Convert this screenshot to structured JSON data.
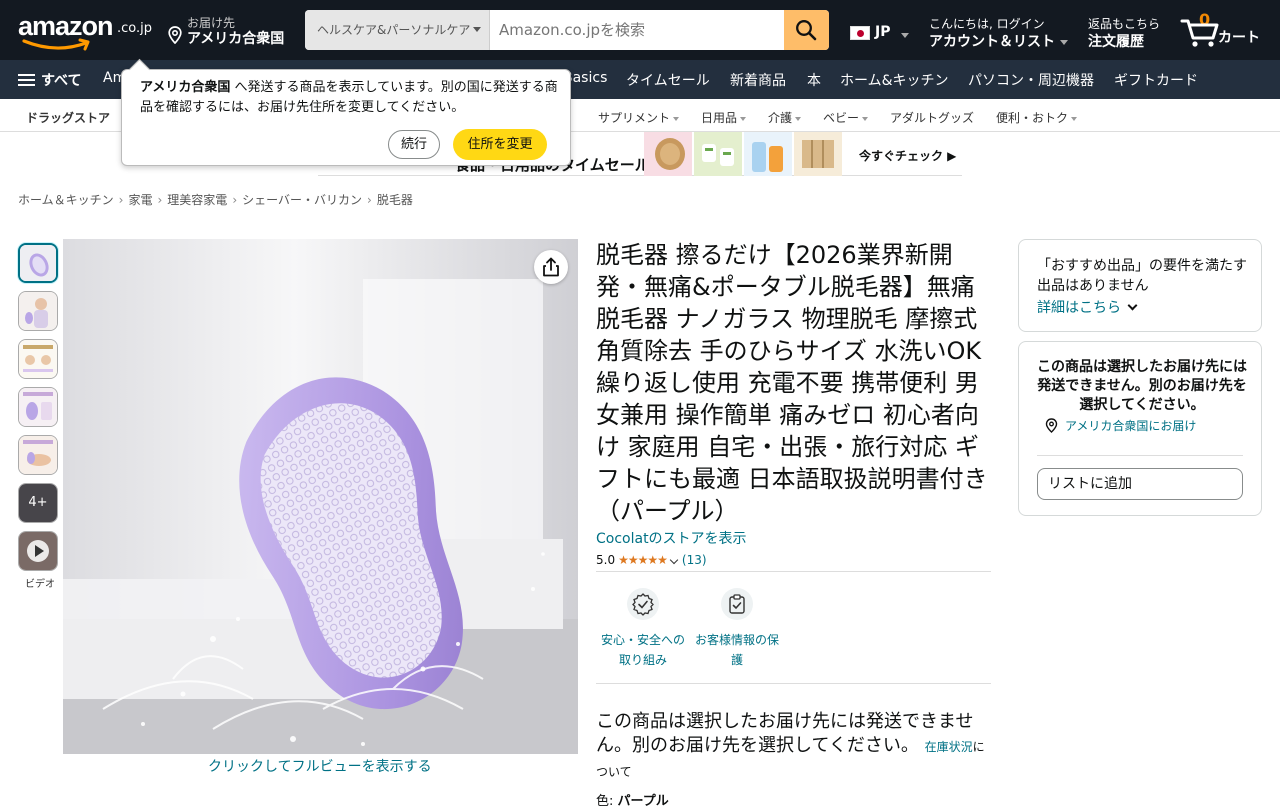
{
  "header": {
    "logo_text": "amazon",
    "logo_tld": ".co.jp",
    "deliver_label": "お届け先",
    "deliver_location": "アメリカ合衆国",
    "search_category": "ヘルスケア&パーソナルケア",
    "search_placeholder": "Amazon.co.jpを検索",
    "language": "JP",
    "account_greeting": "こんにちは, ログイン",
    "account_label": "アカウント＆リスト",
    "returns_label": "返品もこちら",
    "orders_label": "注文履歴",
    "cart_count": "0",
    "cart_label": "カート"
  },
  "nav": {
    "all_label": "すべて",
    "links": [
      "Am",
      "Basics",
      "タイムセール",
      "新着商品",
      "本",
      "ホーム&キッチン",
      "パソコン・周辺機器",
      "ギフトカード"
    ]
  },
  "subnav": {
    "category": "ドラッグストア",
    "items": [
      "サプリメント",
      "日用品",
      "介護",
      "ベビー",
      "アダルトグッズ",
      "便利・おトク"
    ]
  },
  "banner": {
    "text": "食品・日用品のタイムセール",
    "cta": "今すぐチェック ▶"
  },
  "popover": {
    "country": "アメリカ合衆国",
    "message": " へ発送する商品を表示しています。別の国に発送する商品を確認するには、お届け先住所を変更してください。",
    "continue_label": "続行",
    "change_label": "住所を変更"
  },
  "breadcrumb": [
    "ホーム＆キッチン",
    "家電",
    "理美容家電",
    "シェーバー・バリカン",
    "脱毛器"
  ],
  "gallery": {
    "more_label": "4+",
    "video_label": "ビデオ",
    "fullview_label": "クリックしてフルビューを表示する"
  },
  "product": {
    "title": "脱毛器 擦るだけ【2026業界新開発・無痛&ポータブル脱毛器】無痛脱毛器 ナノガラス 物理脱毛 摩擦式 角質除去 手のひらサイズ 水洗いOK 繰り返し使用 充電不要 携帯便利 男女兼用 操作簡単 痛みゼロ 初心者向け 家庭用 自宅・出張・旅行対応 ギフトにも最適 日本語取扱説明書付き（パープル）",
    "store_link": "Cocolatのストアを表示",
    "rating_value": "5.0",
    "stars": "★★★★★",
    "rating_count": "(13)",
    "badge_safety": "安心・安全への取り組み",
    "badge_privacy": "お客様情報の保護",
    "availability": "この商品は選択したお届け先には発送できません。別のお届け先を選択してください。",
    "stock_link": "在庫状況",
    "stock_suffix": "について",
    "color_label": "色: ",
    "color_value": "パープル"
  },
  "buybox": {
    "featured_msg": "「おすすめ出品」の要件を満たす出品はありません",
    "details_link": "詳細はこちら",
    "ship_warning": "この商品は選択したお届け先には発送できません。別のお届け先を選択してください。",
    "deliver_link": "アメリカ合衆国にお届け",
    "add_to_list": "リストに追加"
  },
  "colors": {
    "header_bg": "#131921",
    "nav_bg": "#232f3e",
    "search_button": "#febd69",
    "primary_button": "#ffd814",
    "link": "#007185",
    "star": "#de7921",
    "cart_count": "#f08804",
    "product": "#b9a6e6"
  }
}
